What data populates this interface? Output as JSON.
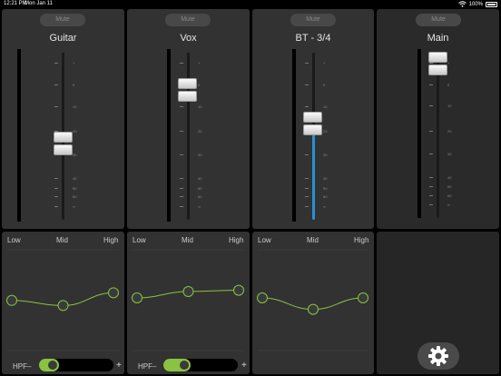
{
  "status_bar": {
    "time": "12:21 PM",
    "date": "Mon Jan 11",
    "battery": "100%"
  },
  "scale_labels": [
    "+",
    "0",
    "10",
    "20",
    "30",
    "40",
    "50",
    "60",
    "∞"
  ],
  "channels": [
    {
      "name": "Guitar",
      "mute_label": "Mute",
      "fader_level": 0.45,
      "active_fill": 0
    },
    {
      "name": "Vox",
      "mute_label": "Mute",
      "fader_level": 0.77,
      "active_fill": 0
    },
    {
      "name": "BT - 3/4",
      "mute_label": "Mute",
      "fader_level": 0.57,
      "active_fill": 0.55
    },
    {
      "name": "Main",
      "mute_label": "Mute",
      "fader_level": 0.93,
      "active_fill": 0
    }
  ],
  "eq": {
    "band_labels": [
      "Low",
      "Mid",
      "High"
    ],
    "hpf_label": "HPF",
    "hpf_minus": "–",
    "hpf_plus": "+",
    "channels": [
      {
        "values": [
          -0.1,
          -0.3,
          0.2
        ],
        "hpf": true,
        "hpf_level": 0.12
      },
      {
        "values": [
          0.0,
          0.25,
          0.3
        ],
        "hpf": true,
        "hpf_level": 0.22
      },
      {
        "values": [
          0.0,
          -0.45,
          0.0
        ],
        "hpf": false,
        "hpf_level": 0
      }
    ]
  },
  "icons": {
    "wifi": "wifi-icon",
    "battery": "battery-icon",
    "settings": "gear-icon"
  },
  "colors": {
    "accent": "#89c341",
    "fader_fill": "#2a8fd6",
    "panel": "#323232"
  }
}
